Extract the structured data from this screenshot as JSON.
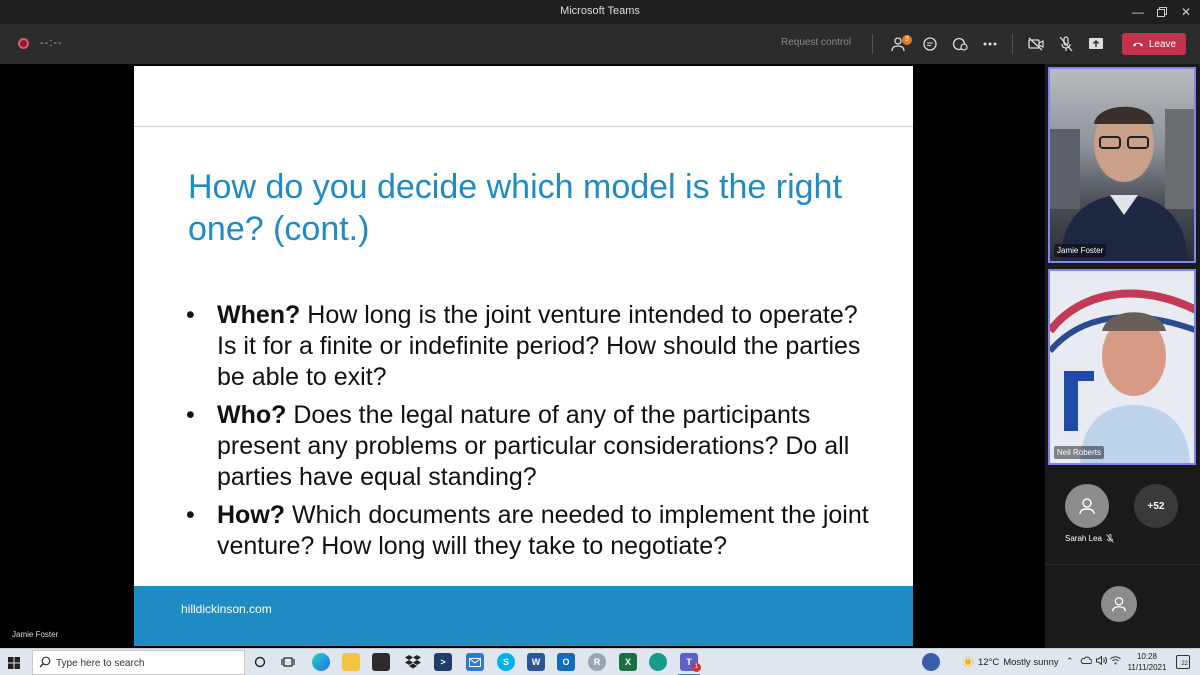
{
  "window": {
    "title": "Microsoft Teams"
  },
  "toolbar": {
    "timer": "--:--",
    "request_control": "Request control",
    "participants_badge": "3",
    "leave_label": "Leave",
    "colors": {
      "leave": "#c4314b",
      "badge": "#e87722"
    }
  },
  "slide": {
    "title": "How do you decide which model is the right one? (cont.)",
    "bullets": [
      {
        "marker": "•",
        "term": "When?",
        "text": " How long is the joint venture intended to operate? Is it for a finite or indefinite period? How should the parties be able to exit?"
      },
      {
        "marker": "•",
        "term": "Who?",
        "text": " Does the legal nature of any of the participants present any problems or particular considerations? Do all parties have equal standing?"
      },
      {
        "marker": "•",
        "term": "How?",
        "text": " Which documents are needed to implement the joint venture? How long will they take to negotiate?"
      }
    ],
    "footer": "hilldickinson.com",
    "accent_color": "#1f8bc4"
  },
  "presenter": {
    "name": "Jamie Foster"
  },
  "participants": {
    "tiles": [
      {
        "name": "Jamie Foster"
      },
      {
        "name": "Neil Roberts"
      }
    ],
    "sarah": {
      "name": "Sarah Lea"
    },
    "more_count": "+52"
  },
  "taskbar": {
    "search_placeholder": "Type here to search",
    "weather_temp": "12°C",
    "weather_desc": "Mostly sunny",
    "time": "10:28",
    "date": "11/11/2021",
    "notifications": "22",
    "teams_badge": "1"
  }
}
